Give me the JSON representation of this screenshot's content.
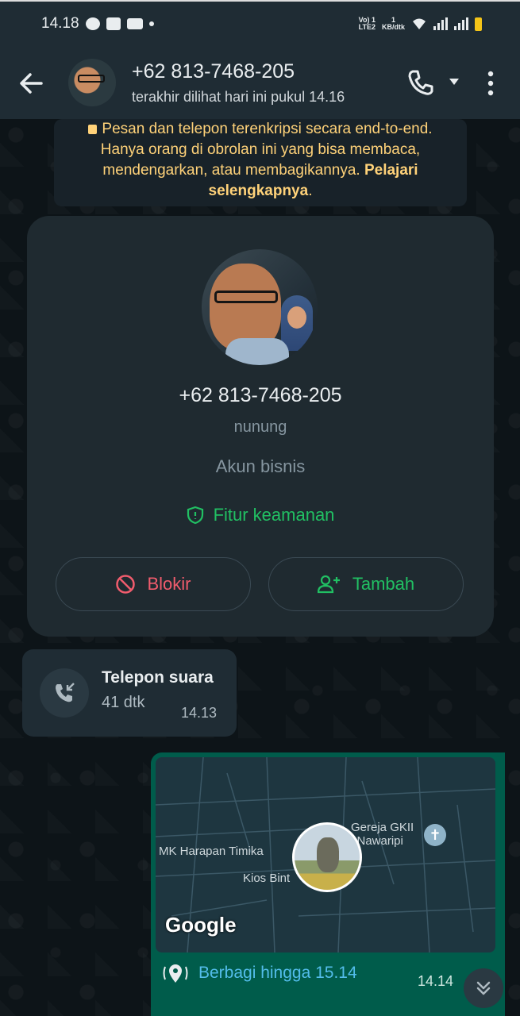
{
  "status_bar": {
    "time": "14.18",
    "network_top": "Vo) 1",
    "network_bottom": "LTE2",
    "speed_top": "1",
    "speed_bottom": "KB/dtk"
  },
  "header": {
    "contact_name": "+62 813-7468-205",
    "last_seen": "terakhir dilihat hari ini pukul 14.16"
  },
  "encryption_notice": {
    "text": "Pesan dan telepon terenkripsi secara end-to-end. Hanya orang di obrolan ini yang bisa membaca, mendengarkan, atau membagikannya.",
    "link": "Pelajari selengkapnya",
    "suffix": "."
  },
  "profile_card": {
    "phone": "+62 813-7468-205",
    "name": "nunung",
    "account_type": "Akun bisnis",
    "security_label": "Fitur keamanan",
    "block_label": "Blokir",
    "add_label": "Tambah"
  },
  "call_message": {
    "title": "Telepon suara",
    "duration": "41 dtk",
    "time": "14.13"
  },
  "location_message": {
    "map_label_left": "MK Harapan Timika",
    "map_label_kios": "Kios Bint",
    "map_label_church_1": "Gereja GKII",
    "map_label_church_2": "l Nawaripi",
    "map_brand": "Google",
    "share_label": "Berbagi hingga 15.14",
    "time": "14.14"
  },
  "colors": {
    "header_bg": "#1f2c34",
    "chat_bg": "#0b141a",
    "notice_text": "#ffd279",
    "green_accent": "#21c063",
    "red_accent": "#f15c6d",
    "outgoing_bubble": "#005c4b",
    "link_blue": "#53bdeb"
  },
  "icons": [
    "back-arrow-icon",
    "voice-call-icon",
    "chevron-down-icon",
    "more-vert-icon",
    "lock-icon",
    "shield-icon",
    "block-icon",
    "add-person-icon",
    "incoming-call-icon",
    "location-pin-icon",
    "double-chevron-down-icon"
  ]
}
